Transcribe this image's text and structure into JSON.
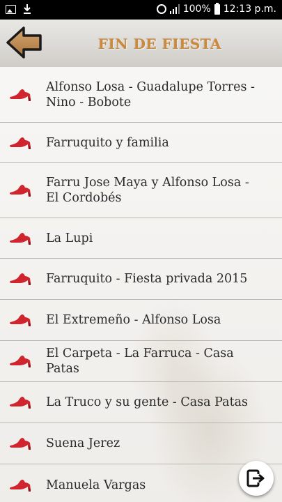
{
  "status_bar": {
    "battery": "100%",
    "time": "12:13 p.m.",
    "icons": [
      "image-icon",
      "download-icon",
      "alarm-icon",
      "signal-icon",
      "battery-icon"
    ]
  },
  "header": {
    "title": "FIN DE FIESTA",
    "back_icon": "arrow-left-icon"
  },
  "colors": {
    "title": "#c9893e",
    "back_arrow": "#b8864e",
    "shoe": "#d0252e",
    "text": "#2a2a2a"
  },
  "items": [
    {
      "label": "Alfonso Losa - Guadalupe Torres - Nino - Bobote"
    },
    {
      "label": "Farruquito y familia"
    },
    {
      "label": "Farru Jose Maya y Alfonso Losa - El Cordobés"
    },
    {
      "label": "La Lupi"
    },
    {
      "label": "Farruquito - Fiesta privada 2015"
    },
    {
      "label": "El Extremeño - Alfonso Losa"
    },
    {
      "label": "El Carpeta - La Farruca - Casa Patas"
    },
    {
      "label": "La Truco y su gente - Casa Patas"
    },
    {
      "label": "Suena Jerez"
    },
    {
      "label": "Manuela Vargas"
    }
  ],
  "fab": {
    "icon": "exit-icon"
  }
}
